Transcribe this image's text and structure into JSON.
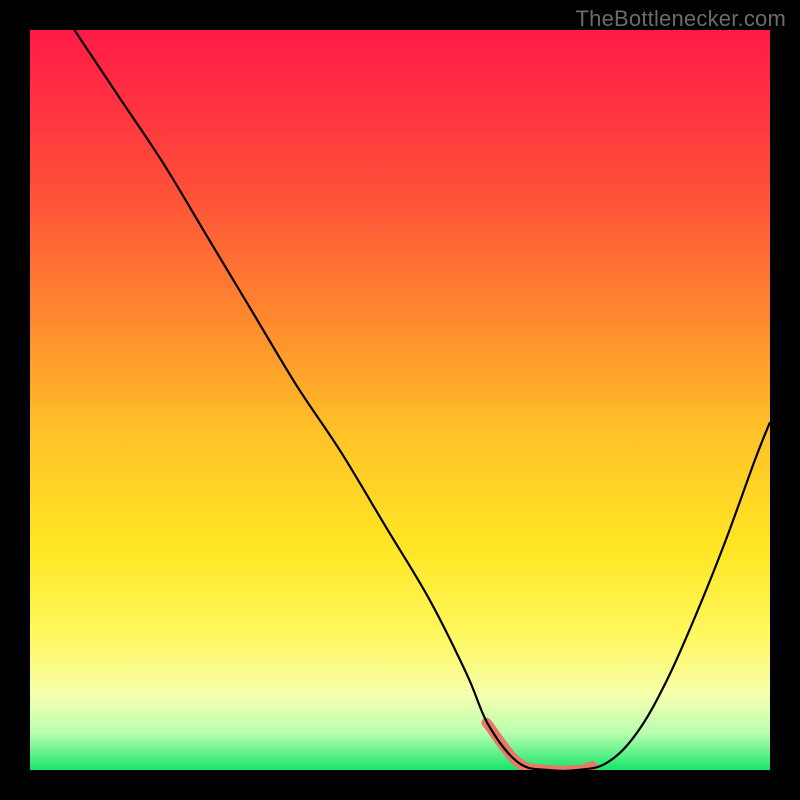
{
  "watermark": "TheBottlenecker.com",
  "chart_data": {
    "type": "line",
    "title": "",
    "xlabel": "",
    "ylabel": "",
    "xlim": [
      0,
      100
    ],
    "ylim": [
      0,
      100
    ],
    "x": [
      6,
      12,
      18,
      24,
      30,
      36,
      42,
      48,
      54,
      59,
      62,
      66,
      70,
      74,
      78,
      82,
      86,
      90,
      94,
      98,
      100
    ],
    "values": [
      100,
      91,
      82,
      72,
      62,
      52,
      43,
      33,
      23,
      13,
      6,
      1,
      0,
      0,
      1,
      5,
      12,
      21,
      31,
      42,
      47
    ],
    "optimal_range_x": [
      62,
      76
    ],
    "gradient_stops": [
      {
        "pos": 0.0,
        "color": "#ff1a47"
      },
      {
        "pos": 0.2,
        "color": "#ff4a3a"
      },
      {
        "pos": 0.4,
        "color": "#ff8c2e"
      },
      {
        "pos": 0.55,
        "color": "#ffc427"
      },
      {
        "pos": 0.7,
        "color": "#ffe624"
      },
      {
        "pos": 0.82,
        "color": "#fff85f"
      },
      {
        "pos": 0.9,
        "color": "#f6ffb0"
      },
      {
        "pos": 0.95,
        "color": "#b7ffb0"
      },
      {
        "pos": 1.0,
        "color": "#19e56a"
      }
    ],
    "highlight_color": "#e9786b",
    "curve_color": "#000000"
  }
}
